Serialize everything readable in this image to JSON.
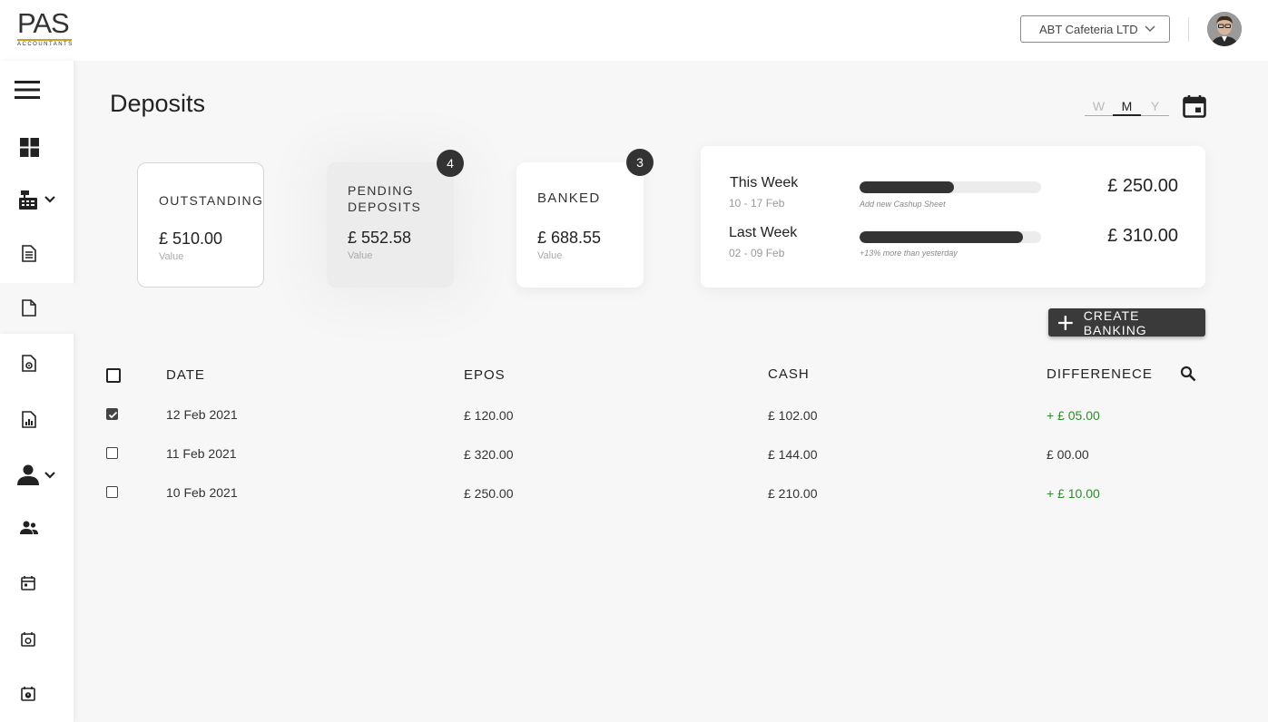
{
  "header": {
    "logo_text": "PAS",
    "logo_sub": "ACCOUNTANTS",
    "company": "ABT Cafeteria LTD"
  },
  "page": {
    "title": "Deposits",
    "period_options": [
      "W",
      "M",
      "Y"
    ],
    "period_selected": "M"
  },
  "cards": {
    "outstanding": {
      "label": "OUTSTANDING",
      "amount": "£ 510.00",
      "sub": "Value"
    },
    "pending": {
      "label_line1": "PENDING",
      "label_line2": "DEPOSITS",
      "amount": "£ 552.58",
      "sub": "Value",
      "badge": "4"
    },
    "banked": {
      "label": "BANKED",
      "amount": "£ 688.55",
      "sub": "Value",
      "badge": "3"
    }
  },
  "weeks": {
    "this_week": {
      "title": "This Week",
      "range": "10 - 17 Feb",
      "note": "Add new Cashup Sheet",
      "amount": "£ 250.00",
      "progress": 0.52
    },
    "last_week": {
      "title": "Last Week",
      "range": "02 - 09 Feb",
      "note": "+13% more than yesterday",
      "amount": "£ 310.00",
      "progress": 0.9
    }
  },
  "actions": {
    "create_banking": "CREATE BANKING"
  },
  "table": {
    "headers": {
      "date": "DATE",
      "epos": "EPOS",
      "cash": "CASH",
      "difference": "DIFFERENECE"
    },
    "rows": [
      {
        "checked": true,
        "date": "12 Feb 2021",
        "epos": "£ 120.00",
        "cash": "£ 102.00",
        "difference": "+ £ 05.00",
        "positive": true
      },
      {
        "checked": false,
        "date": "11 Feb 2021",
        "epos": "£ 320.00",
        "cash": "£ 144.00",
        "difference": "£ 00.00",
        "positive": false
      },
      {
        "checked": false,
        "date": "10 Feb 2021",
        "epos": "£ 250.00",
        "cash": "£ 210.00",
        "difference": "+ £ 10.00",
        "positive": true
      }
    ]
  },
  "colors": {
    "accent_dark": "#333333",
    "positive": "#2e8b2e",
    "logo_gold": "#c9a227"
  },
  "sidebar_icons": [
    "menu-icon",
    "dashboard-icon",
    "cash-register-icon",
    "document-list-icon",
    "file-icon",
    "file-settings-icon",
    "report-icon",
    "user-icon",
    "users-icon",
    "calendar-icon",
    "calendar-settings-icon",
    "calendar-alert-icon"
  ]
}
